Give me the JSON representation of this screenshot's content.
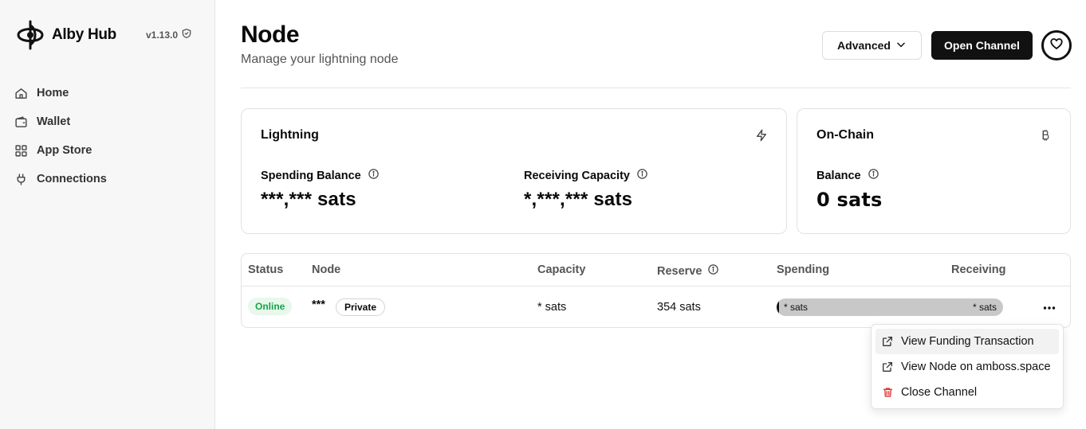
{
  "sidebar": {
    "brand": "Alby Hub",
    "version": "v1.13.0",
    "items": [
      {
        "label": "Home",
        "icon": "home-icon"
      },
      {
        "label": "Wallet",
        "icon": "wallet-icon"
      },
      {
        "label": "App Store",
        "icon": "grid-icon"
      },
      {
        "label": "Connections",
        "icon": "plug-icon"
      }
    ]
  },
  "header": {
    "title": "Node",
    "subtitle": "Manage your lightning node",
    "advanced_label": "Advanced",
    "open_channel_label": "Open Channel"
  },
  "lightning": {
    "title": "Lightning",
    "spending_label": "Spending Balance",
    "spending_value": "***,*** sats",
    "receiving_label": "Receiving Capacity",
    "receiving_value": "*,***,*** sats"
  },
  "onchain": {
    "title": "On-Chain",
    "balance_label": "Balance",
    "balance_value": "0 sats"
  },
  "table": {
    "headers": {
      "status": "Status",
      "node": "Node",
      "capacity": "Capacity",
      "reserve": "Reserve",
      "spending": "Spending",
      "receiving": "Receiving"
    },
    "rows": [
      {
        "status": "Online",
        "node_alias": "***",
        "visibility": "Private",
        "capacity": "* sats",
        "reserve": "354 sats",
        "spending": "* sats",
        "receiving": "* sats",
        "spending_fraction": 0.01
      }
    ]
  },
  "menu": {
    "items": [
      {
        "label": "View Funding Transaction",
        "icon": "external-link-icon"
      },
      {
        "label": "View Node on amboss.space",
        "icon": "external-link-icon"
      },
      {
        "label": "Close Channel",
        "icon": "trash-icon"
      }
    ]
  },
  "colors": {
    "online_bg": "#e8f8ec",
    "online_text": "#16a34a",
    "danger": "#dc2626",
    "primary": "#111111"
  }
}
